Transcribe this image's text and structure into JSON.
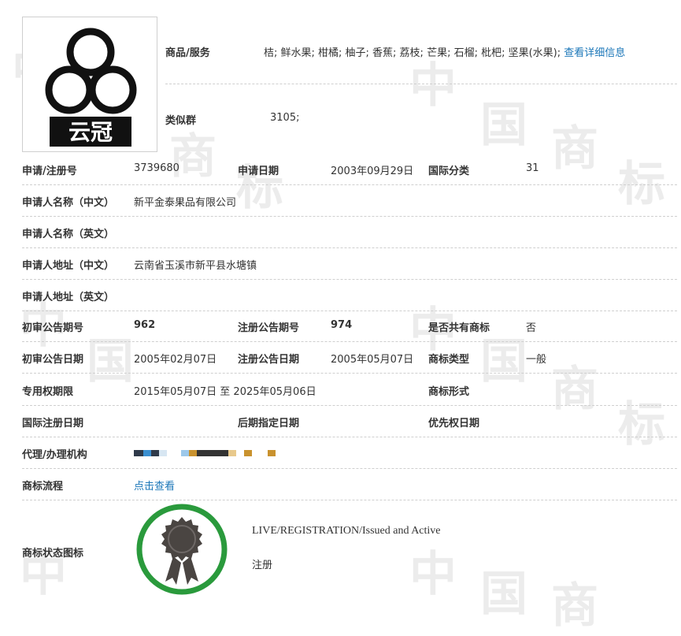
{
  "watermark_chars": [
    "中",
    "国",
    "商",
    "标"
  ],
  "goods": {
    "label": "商品/服务",
    "value": "桔; 鲜水果; 柑橘; 柚子; 香蕉; 荔枝; 芒果; 石榴; 枇杷; 坚果(水果);",
    "detail_link": "查看详细信息"
  },
  "similar_group": {
    "label": "类似群",
    "value": "3105;"
  },
  "logo_text": "云冠",
  "rows": {
    "reg_no": {
      "label": "申请/注册号",
      "value": "3739680"
    },
    "app_date": {
      "label": "申请日期",
      "value": "2003年09月29日"
    },
    "intl_class": {
      "label": "国际分类",
      "value": "31"
    },
    "applicant_cn": {
      "label": "申请人名称（中文）",
      "value": "新平金泰果品有限公司"
    },
    "applicant_en": {
      "label": "申请人名称（英文）",
      "value": ""
    },
    "address_cn": {
      "label": "申请人地址（中文）",
      "value": "云南省玉溪市新平县水塘镇"
    },
    "address_en": {
      "label": "申请人地址（英文）",
      "value": ""
    },
    "prelim_issue": {
      "label": "初审公告期号",
      "value": "962"
    },
    "reg_issue": {
      "label": "注册公告期号",
      "value": "974"
    },
    "shared_mark": {
      "label": "是否共有商标",
      "value": "否"
    },
    "prelim_date": {
      "label": "初审公告日期",
      "value": "2005年02月07日"
    },
    "reg_pub_date": {
      "label": "注册公告日期",
      "value": "2005年05月07日"
    },
    "mark_type": {
      "label": "商标类型",
      "value": "一般"
    },
    "exclusive_period": {
      "label": "专用权期限",
      "value": "2015年05月07日 至 2025年05月06日"
    },
    "mark_form": {
      "label": "商标形式",
      "value": ""
    },
    "intl_reg_date": {
      "label": "国际注册日期",
      "value": ""
    },
    "later_designation": {
      "label": "后期指定日期",
      "value": ""
    },
    "priority_date": {
      "label": "优先权日期",
      "value": ""
    },
    "agency": {
      "label": "代理/办理机构",
      "value": ""
    },
    "process": {
      "label": "商标流程",
      "link": "点击查看"
    },
    "status_icon": {
      "label": "商标状态图标"
    }
  },
  "status": {
    "english": "LIVE/REGISTRATION/Issued and Active",
    "chinese": "注册"
  },
  "colors": {
    "link": "#1a76b8",
    "badge_ring": "#2a9a3c",
    "badge_seal": "#4a4542",
    "redaction": [
      "#2f3a4a",
      "#3a8fd0",
      "#d7e6f2",
      "#c9922e",
      "#e8c98c",
      "#333333"
    ]
  }
}
